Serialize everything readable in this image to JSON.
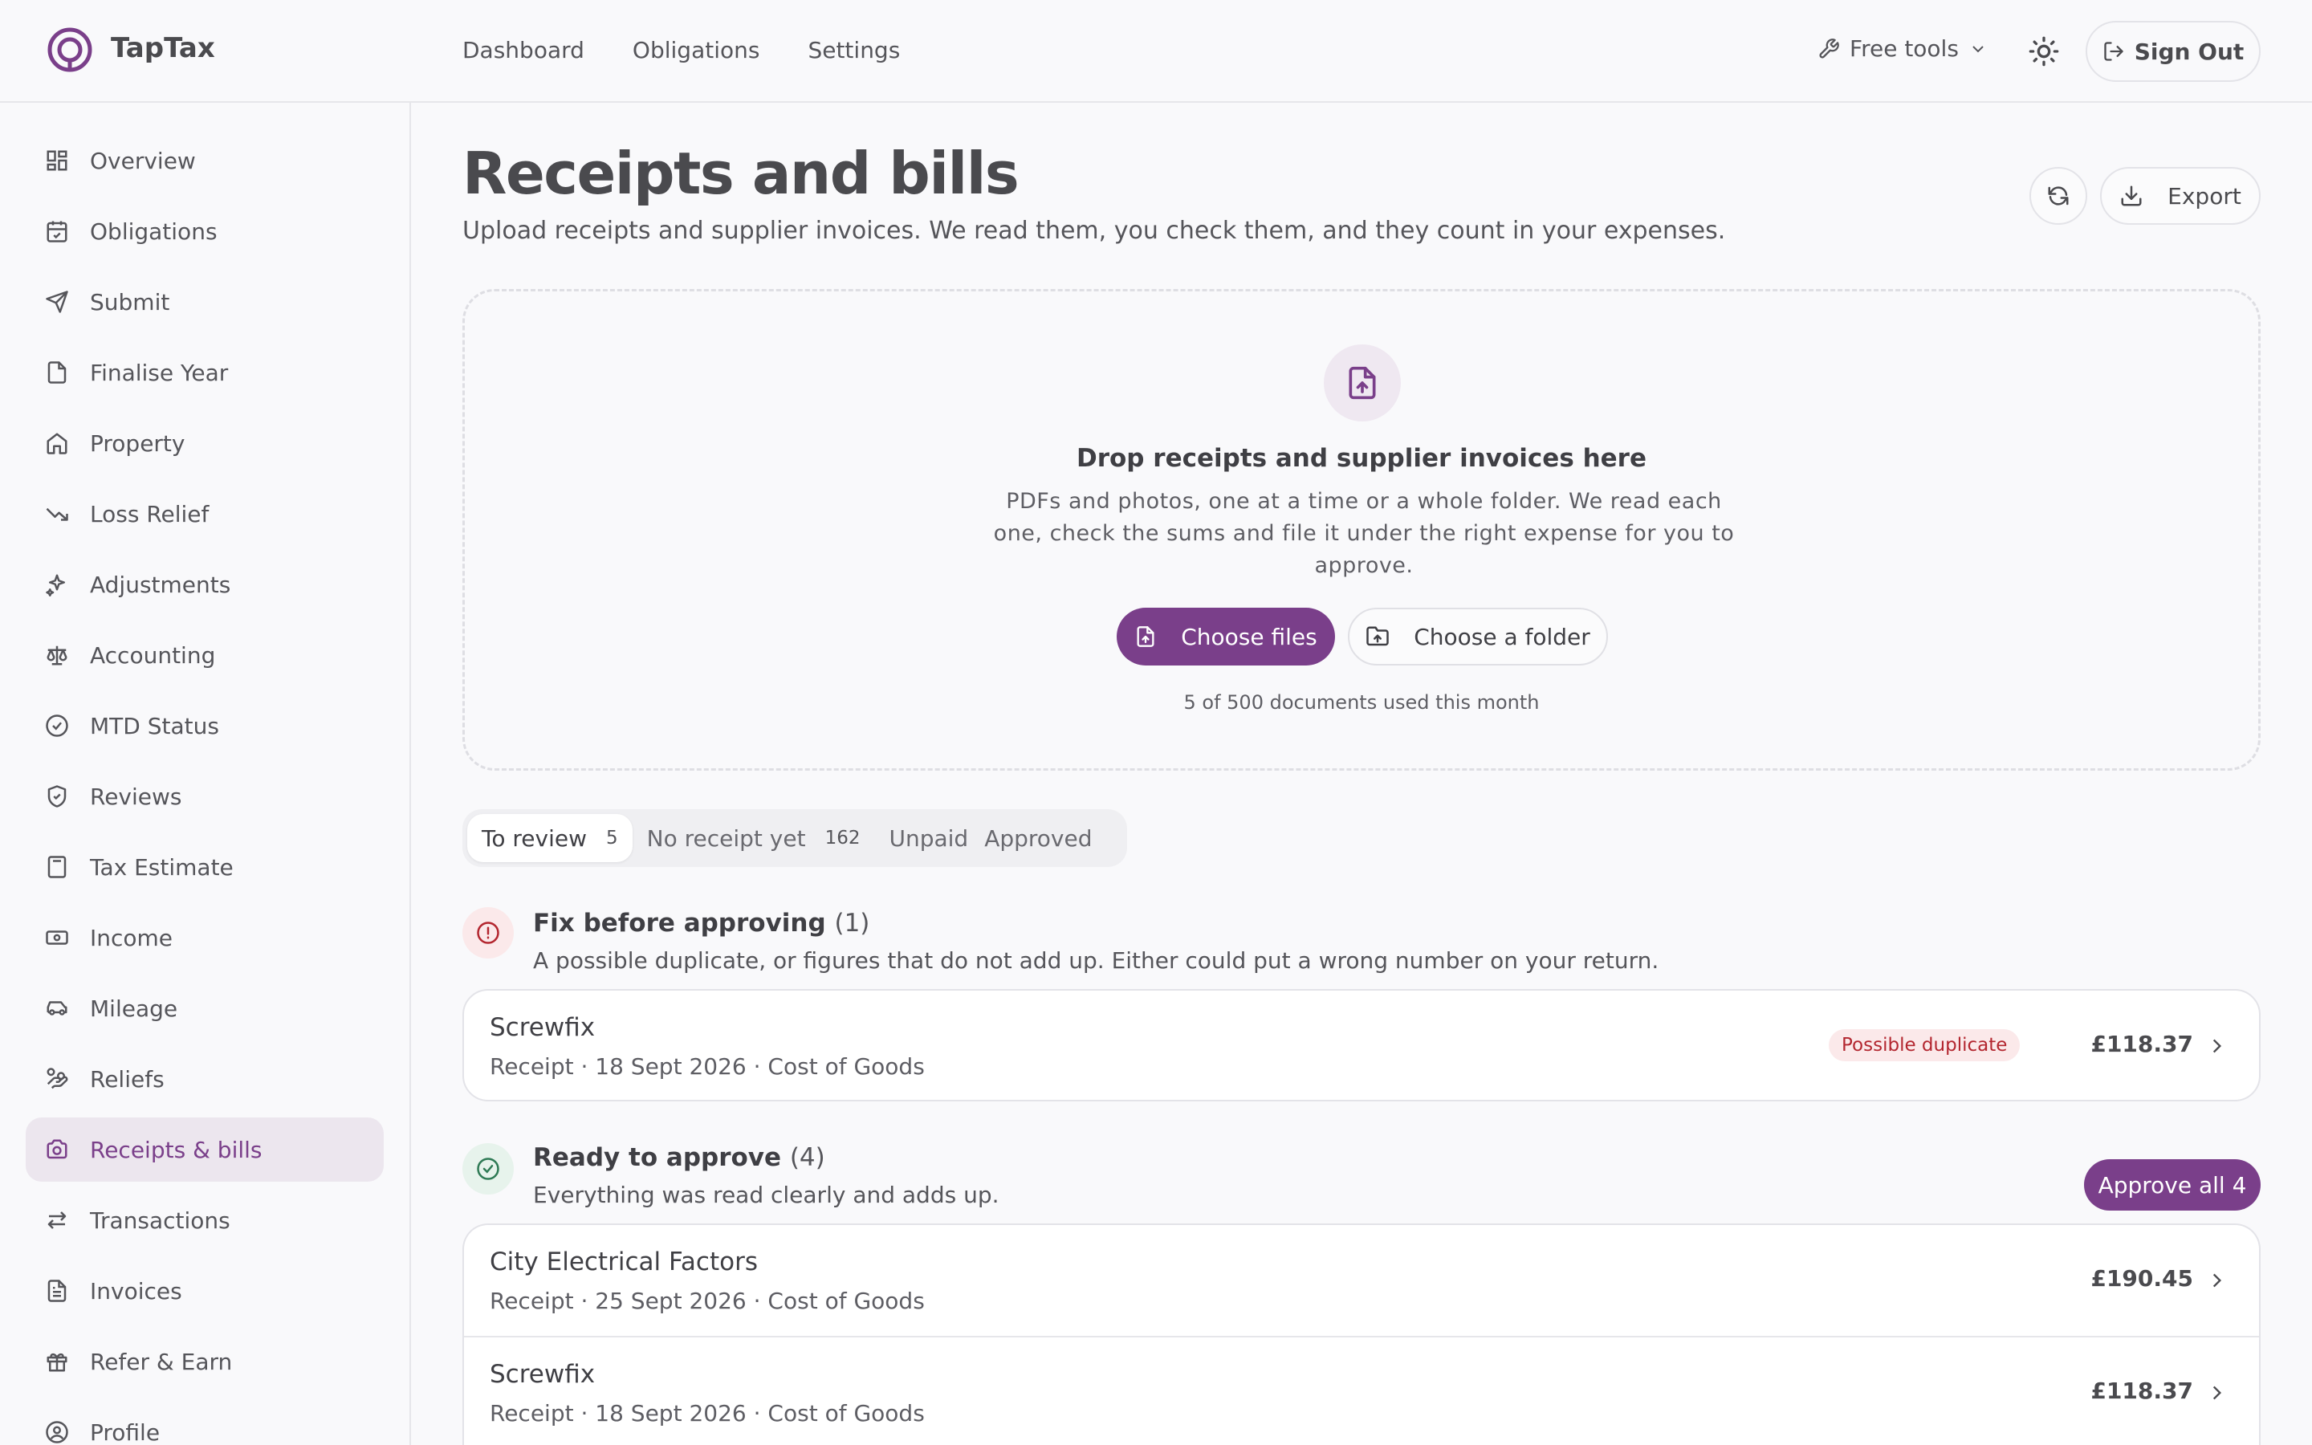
{
  "app": {
    "name": "TapTax"
  },
  "topnav": {
    "items": [
      "Dashboard",
      "Obligations",
      "Settings"
    ],
    "free_tools": "Free tools",
    "sign_out": "Sign Out"
  },
  "sidebar": {
    "items": [
      {
        "label": "Overview",
        "icon": "grid-icon"
      },
      {
        "label": "Obligations",
        "icon": "calendar-check-icon"
      },
      {
        "label": "Submit",
        "icon": "send-icon"
      },
      {
        "label": "Finalise Year",
        "icon": "file-icon"
      },
      {
        "label": "Property",
        "icon": "home-icon"
      },
      {
        "label": "Loss Relief",
        "icon": "trending-down-icon"
      },
      {
        "label": "Adjustments",
        "icon": "sparkles-icon"
      },
      {
        "label": "Accounting",
        "icon": "scale-icon"
      },
      {
        "label": "MTD Status",
        "icon": "check-circle-icon"
      },
      {
        "label": "Reviews",
        "icon": "shield-check-icon"
      },
      {
        "label": "Tax Estimate",
        "icon": "calculator-icon"
      },
      {
        "label": "Income",
        "icon": "banknote-icon"
      },
      {
        "label": "Mileage",
        "icon": "car-icon"
      },
      {
        "label": "Reliefs",
        "icon": "hand-coins-icon"
      },
      {
        "label": "Receipts & bills",
        "icon": "camera-icon",
        "active": true
      },
      {
        "label": "Transactions",
        "icon": "arrows-icon"
      },
      {
        "label": "Invoices",
        "icon": "invoice-icon"
      },
      {
        "label": "Refer & Earn",
        "icon": "gift-icon"
      },
      {
        "label": "Profile",
        "icon": "user-circle-icon"
      }
    ]
  },
  "page": {
    "title": "Receipts and bills",
    "subtitle": "Upload receipts and supplier invoices. We read them, you check them, and they count in your expenses.",
    "export_label": "Export"
  },
  "dropzone": {
    "title": "Drop receipts and supplier invoices here",
    "text": "PDFs and photos, one at a time or a whole folder. We read each one, check the sums and file it under the right expense for you to approve.",
    "choose_files": "Choose files",
    "choose_folder": "Choose a folder",
    "usage": "5 of 500 documents used this month"
  },
  "tabs": [
    {
      "label": "To review",
      "count": "5",
      "active": true
    },
    {
      "label": "No receipt yet",
      "count": "162"
    },
    {
      "label": "Unpaid",
      "count": ""
    },
    {
      "label": "Approved",
      "count": ""
    }
  ],
  "fix_section": {
    "title": "Fix before approving",
    "count": "(1)",
    "desc": "A possible duplicate, or figures that do not add up. Either could put a wrong number on your return.",
    "items": [
      {
        "name": "Screwfix",
        "meta": "Receipt · 18 Sept 2026 · Cost of Goods",
        "badge": "Possible duplicate",
        "amount": "£118.37"
      }
    ]
  },
  "ready_section": {
    "title": "Ready to approve",
    "count": "(4)",
    "desc": "Everything was read clearly and adds up.",
    "approve_all": "Approve all 4",
    "items": [
      {
        "name": "City Electrical Factors",
        "meta": "Receipt · 25 Sept 2026 · Cost of Goods",
        "amount": "£190.45"
      },
      {
        "name": "Screwfix",
        "meta": "Receipt · 18 Sept 2026 · Cost of Goods",
        "amount": "£118.37"
      }
    ]
  },
  "colors": {
    "accent": "#7a3f8a",
    "danger": "#b3262f",
    "success": "#2f7a55"
  }
}
